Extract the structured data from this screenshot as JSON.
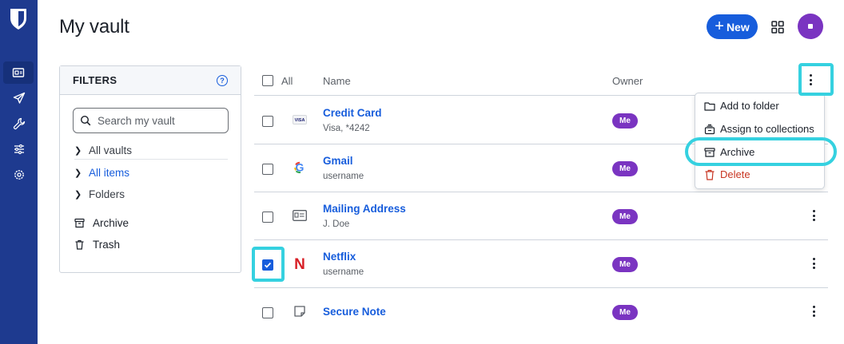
{
  "header": {
    "title": "My vault",
    "new_label": "New",
    "new_plus": "+"
  },
  "rail": {
    "items": [
      "vault-icon",
      "send-icon",
      "tools-icon",
      "reports-icon",
      "settings-icon"
    ]
  },
  "filters": {
    "heading": "FILTERS",
    "help": "?",
    "search_placeholder": "Search my vault",
    "tree": [
      {
        "label": "All vaults"
      },
      {
        "label": "All items"
      },
      {
        "label": "Folders"
      }
    ],
    "extras": [
      {
        "label": "Archive"
      },
      {
        "label": "Trash"
      }
    ]
  },
  "table": {
    "headers": {
      "all": "All",
      "name": "Name",
      "owner": "Owner"
    },
    "rows": [
      {
        "name": "Credit Card",
        "sub": "Visa, *4242",
        "owner": "Me",
        "icon": "visa-icon",
        "icon_text": "VISA",
        "checked": false
      },
      {
        "name": "Gmail",
        "sub": "username",
        "owner": "Me",
        "icon": "google-icon",
        "icon_text": "G",
        "checked": false
      },
      {
        "name": "Mailing Address",
        "sub": "J. Doe",
        "owner": "Me",
        "icon": "id-card-icon",
        "checked": false
      },
      {
        "name": "Netflix",
        "sub": "username",
        "owner": "Me",
        "icon": "netflix-icon",
        "icon_text": "N",
        "checked": true
      },
      {
        "name": "Secure Note",
        "sub": "",
        "owner": "Me",
        "icon": "note-icon",
        "checked": false
      }
    ]
  },
  "bulk_menu": {
    "items": [
      {
        "label": "Add to folder",
        "icon": "folder-icon"
      },
      {
        "label": "Assign to collections",
        "icon": "collections-icon"
      },
      {
        "label": "Archive",
        "icon": "archive-icon"
      },
      {
        "label": "Delete",
        "icon": "trash-icon"
      }
    ]
  },
  "colors": {
    "brand": "#175ddc",
    "rail": "#1e3a8f",
    "badge": "#7a34c1",
    "danger": "#c83522",
    "highlight": "#35d1e0"
  }
}
